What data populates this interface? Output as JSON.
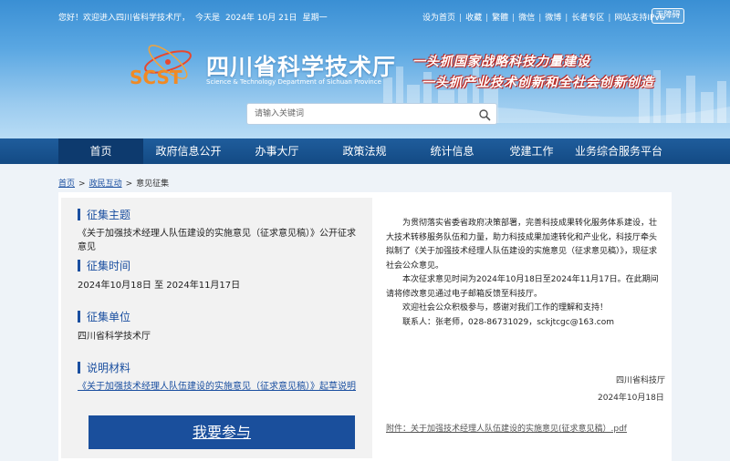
{
  "topbar": {
    "greeting": "您好！欢迎进入四川省科学技术厅，",
    "today_prefix": "今天是",
    "date": "2024年 10月 21日",
    "weekday": "星期一",
    "links": [
      "设为首页",
      "收藏",
      "繁體",
      "微信",
      "微博",
      "长者专区",
      "网站支持IPv6"
    ],
    "access_button": "无障碍"
  },
  "brand": {
    "logo_text": "SCST",
    "title": "四川省科学技术厅",
    "subtitle_en": "Science & Technology Department of Sichuan Province",
    "slogan_1": "一头抓国家战略科技力量建设",
    "slogan_2": "一头抓产业技术创新和全社会创新创造",
    "colors": {
      "brand_blue": "#1a4f9c",
      "nav_blue": "#134a84",
      "slogan_red": "#c0392b"
    }
  },
  "search": {
    "placeholder": "请输入关键词",
    "icon": "search-icon"
  },
  "nav": {
    "items": [
      "首页",
      "政府信息公开",
      "办事大厅",
      "政策法规",
      "统计信息",
      "党建工作",
      "业务综合服务平台"
    ],
    "active_index": 0
  },
  "breadcrumb": {
    "home": "首页",
    "section": "政民互动",
    "current": "意见征集",
    "separator": ">"
  },
  "consultation": {
    "topic_heading": "征集主题",
    "topic": "《关于加强技术经理人队伍建设的实施意见（征求意见稿）》公开征求意见",
    "period_heading": "征集时间",
    "period": "2024年10月18日 至 2024年11月17日",
    "org_heading": "征集单位",
    "org": "四川省科学技术厅",
    "material_heading": "说明材料",
    "material_link": "《关于加强技术经理人队伍建设的实施意见（征求意见稿）》起草说明",
    "join_button": "我要参与"
  },
  "notice": {
    "paragraphs": [
      "为贯彻落实省委省政府决策部署，完善科技成果转化服务体系建设，壮大技术转移服务队伍和力量，助力科技成果加速转化和产业化，科技厅牵头拟制了《关于加强技术经理人队伍建设的实施意见（征求意见稿）》，现征求社会公众意见。",
      "本次征求意见时间为2024年10月18日至2024年11月17日。在此期间请将修改意见通过电子邮箱反馈至科技厅。",
      "欢迎社会公众积极参与，感谢对我们工作的理解和支持！",
      "联系人：张老师，028-86731029，sckjtcgc@163.com"
    ],
    "sign_org": "四川省科技厅",
    "sign_date": "2024年10月18日",
    "attachment": "附件：关于加强技术经理人队伍建设的实施意见(征求意见稿）.pdf"
  }
}
